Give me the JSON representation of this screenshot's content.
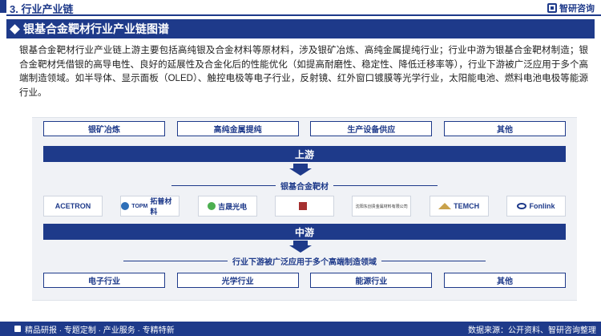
{
  "header": {
    "section_title": "3. 行业产业链",
    "brand": "智研咨询"
  },
  "title": "银基合金靶材行业产业链图谱",
  "intro": "银基合金靶材行业产业链上游主要包括高纯银及合金材料等原材料，涉及银矿冶炼、高纯金属提纯行业；行业中游为银基合金靶材制造；银合金靶材凭借银的高导电性、良好的延展性及合金化后的性能优化（如提高耐磨性、稳定性、降低迁移率等），行业下游被广泛应用于多个高端制造领域。如半导体、显示面板（OLED）、触控电极等电子行业，反射镜、红外窗口镀膜等光学行业，太阳能电池、燃料电池电极等能源行业。",
  "diagram": {
    "upstream_items": [
      "银矿冶炼",
      "高纯金属提纯",
      "生产设备供应",
      "其他"
    ],
    "upstream_label": "上游",
    "midstream_title": "银基合金靶材",
    "companies": [
      "ACETRON",
      "TOPM",
      "拓普材料",
      "吉晟光电",
      "",
      "沈阳东创贵金属材料有限公司",
      "TEMCH",
      "Fonlink"
    ],
    "midstream_label": "中游",
    "downstream_title": "行业下游被广泛应用于多个高端制造领域",
    "downstream_items": [
      "电子行业",
      "光学行业",
      "能源行业",
      "其他"
    ]
  },
  "footer": {
    "left_text": "精品研报 · 专题定制 · 产业服务 · 专精特新",
    "source": "数据来源：公开资料、智研咨询整理"
  }
}
